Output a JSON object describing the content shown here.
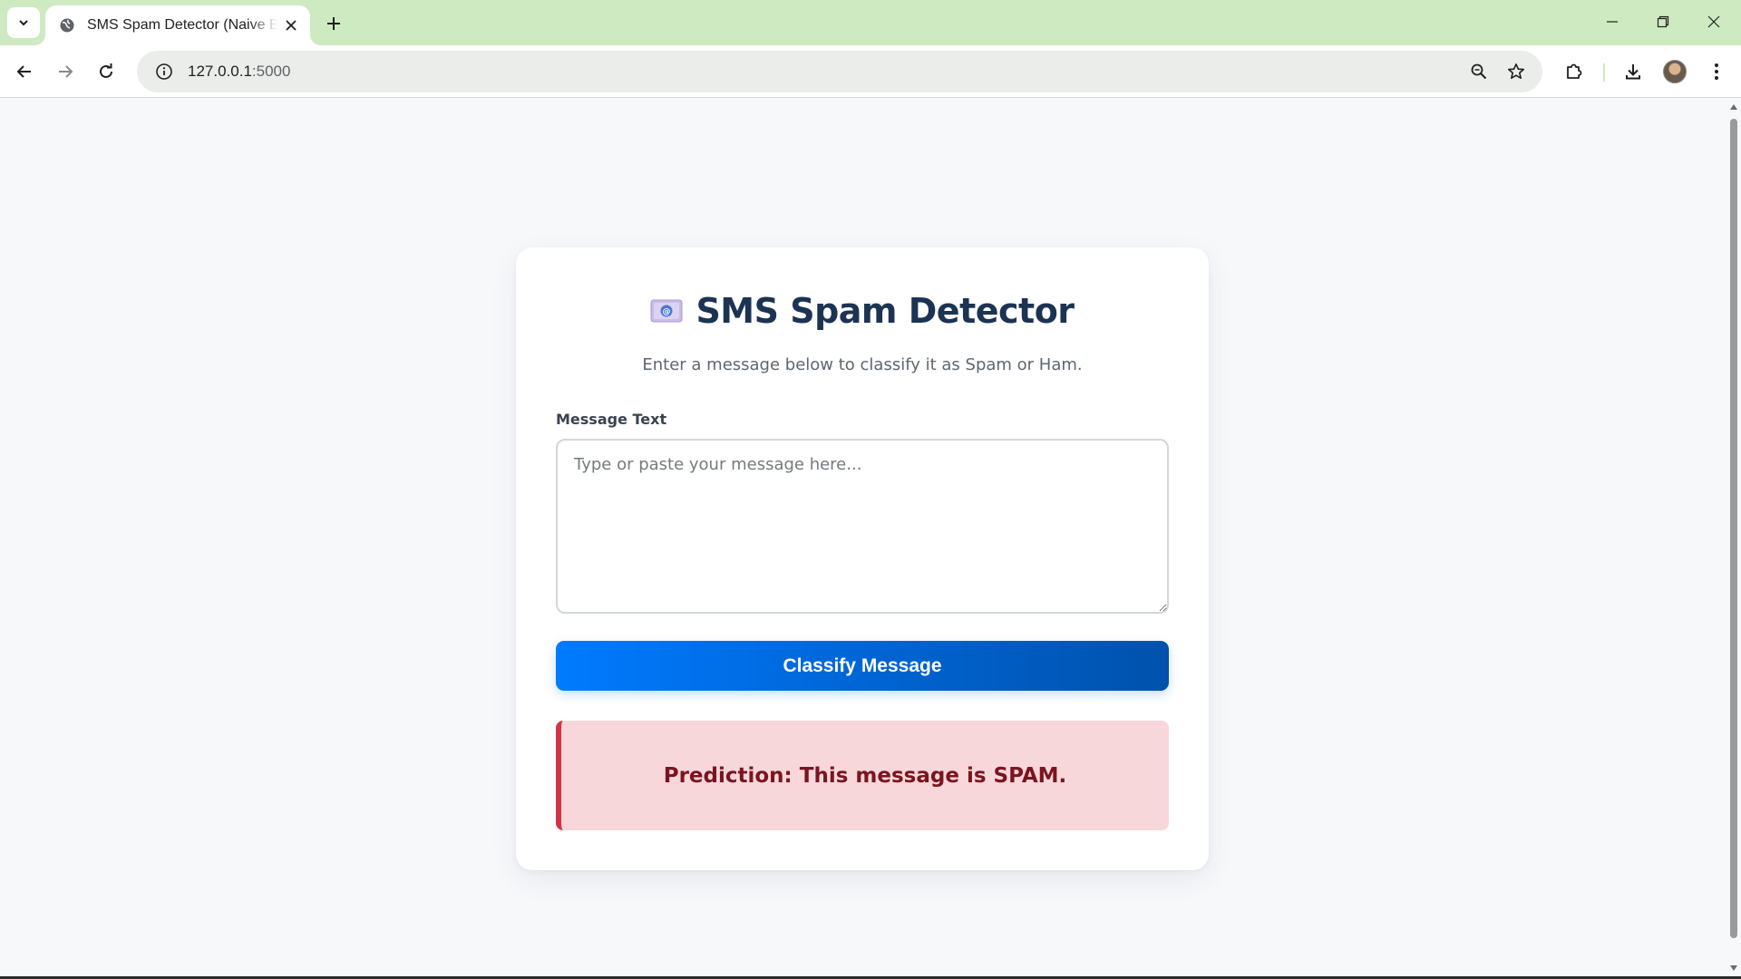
{
  "browser": {
    "tab_title": "SMS Spam Detector (Naive Bayes)",
    "url_host": "127.0.0.1",
    "url_port": ":5000"
  },
  "page": {
    "title": "SMS Spam Detector",
    "subtitle": "Enter a message below to classify it as Spam or Ham.",
    "message_label": "Message Text",
    "message_placeholder": "Type or paste your message here...",
    "message_value": "",
    "classify_button": "Classify Message",
    "prediction": "Prediction: This message is SPAM."
  },
  "colors": {
    "tabstrip": "#cdeac0",
    "title": "#1c3353",
    "button": "#007bff",
    "result_bg": "#f8d7da",
    "result_border": "#d33445",
    "result_text": "#7a1520"
  },
  "icons": {
    "title": "email-envelope-icon",
    "tab": "globe-icon"
  }
}
